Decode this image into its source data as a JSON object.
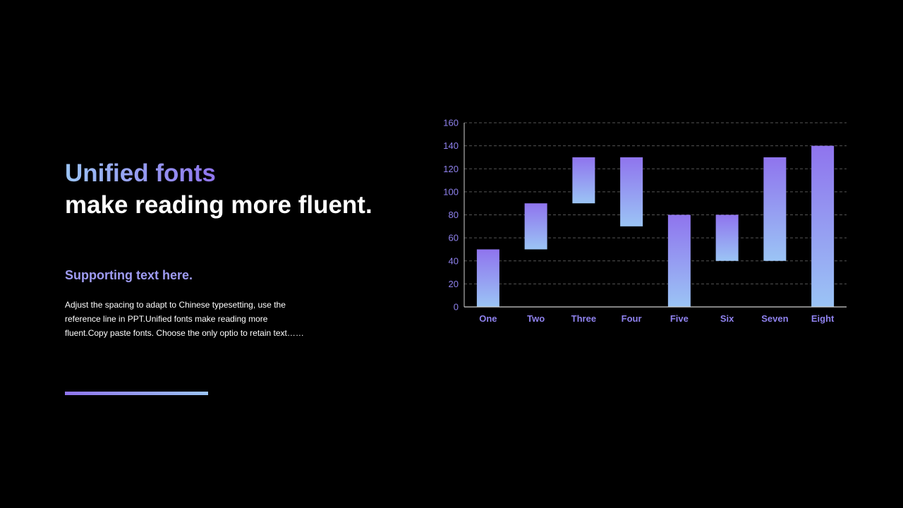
{
  "slide": {
    "headline_line1": "Unified fonts",
    "headline_line2": "make reading more fluent.",
    "supporting_title": "Supporting text here.",
    "body_text": "Adjust the spacing to adapt to Chinese typesetting, use the reference line in PPT.Unified fonts make reading more fluent.Copy paste fonts. Choose the only optio to retain text……"
  },
  "colors": {
    "background": "#000000",
    "accent_purple": "#8f74ee",
    "accent_blue": "#9bc4f5",
    "axis_text": "#8f82ee"
  },
  "chart_data": {
    "type": "bar",
    "subtype": "floating-range",
    "categories": [
      "One",
      "Two",
      "Three",
      "Four",
      "Five",
      "Six",
      "Seven",
      "Eight"
    ],
    "ranges": [
      [
        0,
        50
      ],
      [
        50,
        90
      ],
      [
        90,
        130
      ],
      [
        70,
        130
      ],
      [
        0,
        80
      ],
      [
        40,
        80
      ],
      [
        40,
        130
      ],
      [
        0,
        140
      ]
    ],
    "ylim": [
      0,
      160
    ],
    "yticks": [
      0,
      20,
      40,
      60,
      80,
      100,
      120,
      140,
      160
    ],
    "grid": true,
    "legend": "none"
  }
}
